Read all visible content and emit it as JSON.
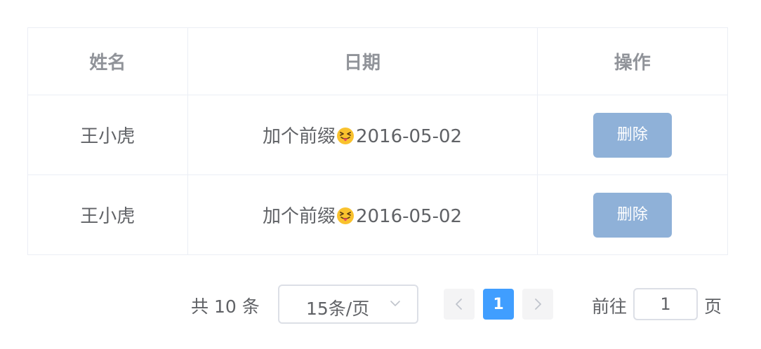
{
  "table": {
    "headers": [
      "姓名",
      "日期",
      "操作"
    ],
    "rows": [
      {
        "name": "王小虎",
        "date_prefix": "加个前缀",
        "emoji": "squinting-face-with-tongue-icon",
        "date": "2016-05-02",
        "action": "删除"
      },
      {
        "name": "王小虎",
        "date_prefix": "加个前缀",
        "emoji": "squinting-face-with-tongue-icon",
        "date": "2016-05-02",
        "action": "删除"
      }
    ]
  },
  "pagination": {
    "total_text": "共 10 条",
    "page_size": "15条/页",
    "current_page": "1",
    "jump_label": "前往",
    "jump_value": "1",
    "jump_suffix": "页"
  },
  "colors": {
    "accent": "#409eff",
    "delete_button": "#8fb1d8",
    "border": "#ebeef5"
  }
}
